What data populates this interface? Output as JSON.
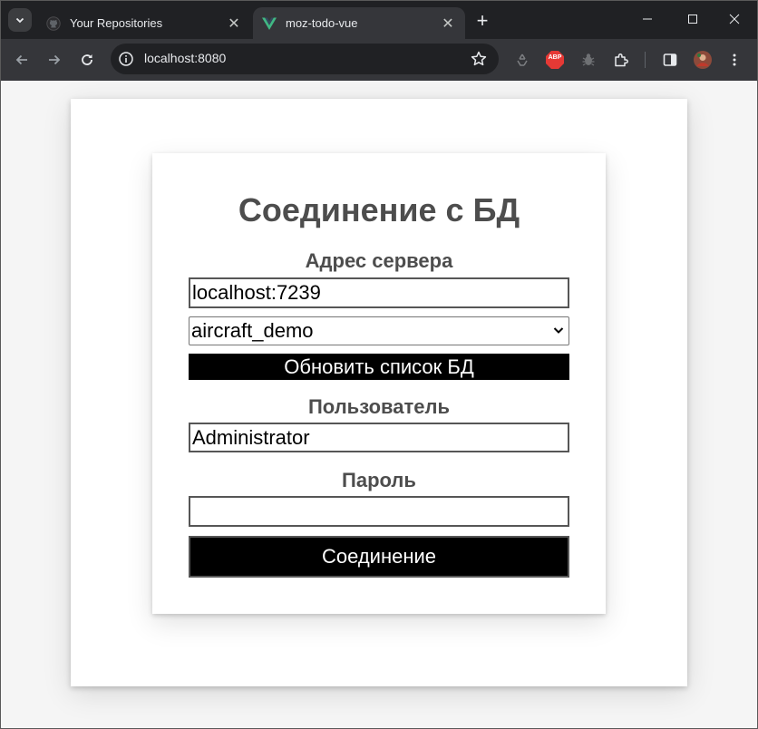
{
  "browser": {
    "tabs": [
      {
        "title": "Your Repositories",
        "active": false
      },
      {
        "title": "moz-todo-vue",
        "active": true
      }
    ],
    "url": "localhost:8080",
    "extensions": {
      "abp_label": "ABP"
    }
  },
  "form": {
    "title": "Соединение с БД",
    "server_label": "Адрес сервера",
    "server_value": "localhost:7239",
    "db_selected": "aircraft_demo",
    "refresh_button": "Обновить список БД",
    "user_label": "Пользователь",
    "user_value": "Administrator",
    "password_label": "Пароль",
    "password_value": "",
    "connect_button": "Соединение"
  },
  "colors": {
    "title": "#4d4d4d",
    "button_bg": "#000000",
    "button_text": "#ffffff",
    "vue_green": "#41b883",
    "abp_red": "#e53935"
  }
}
